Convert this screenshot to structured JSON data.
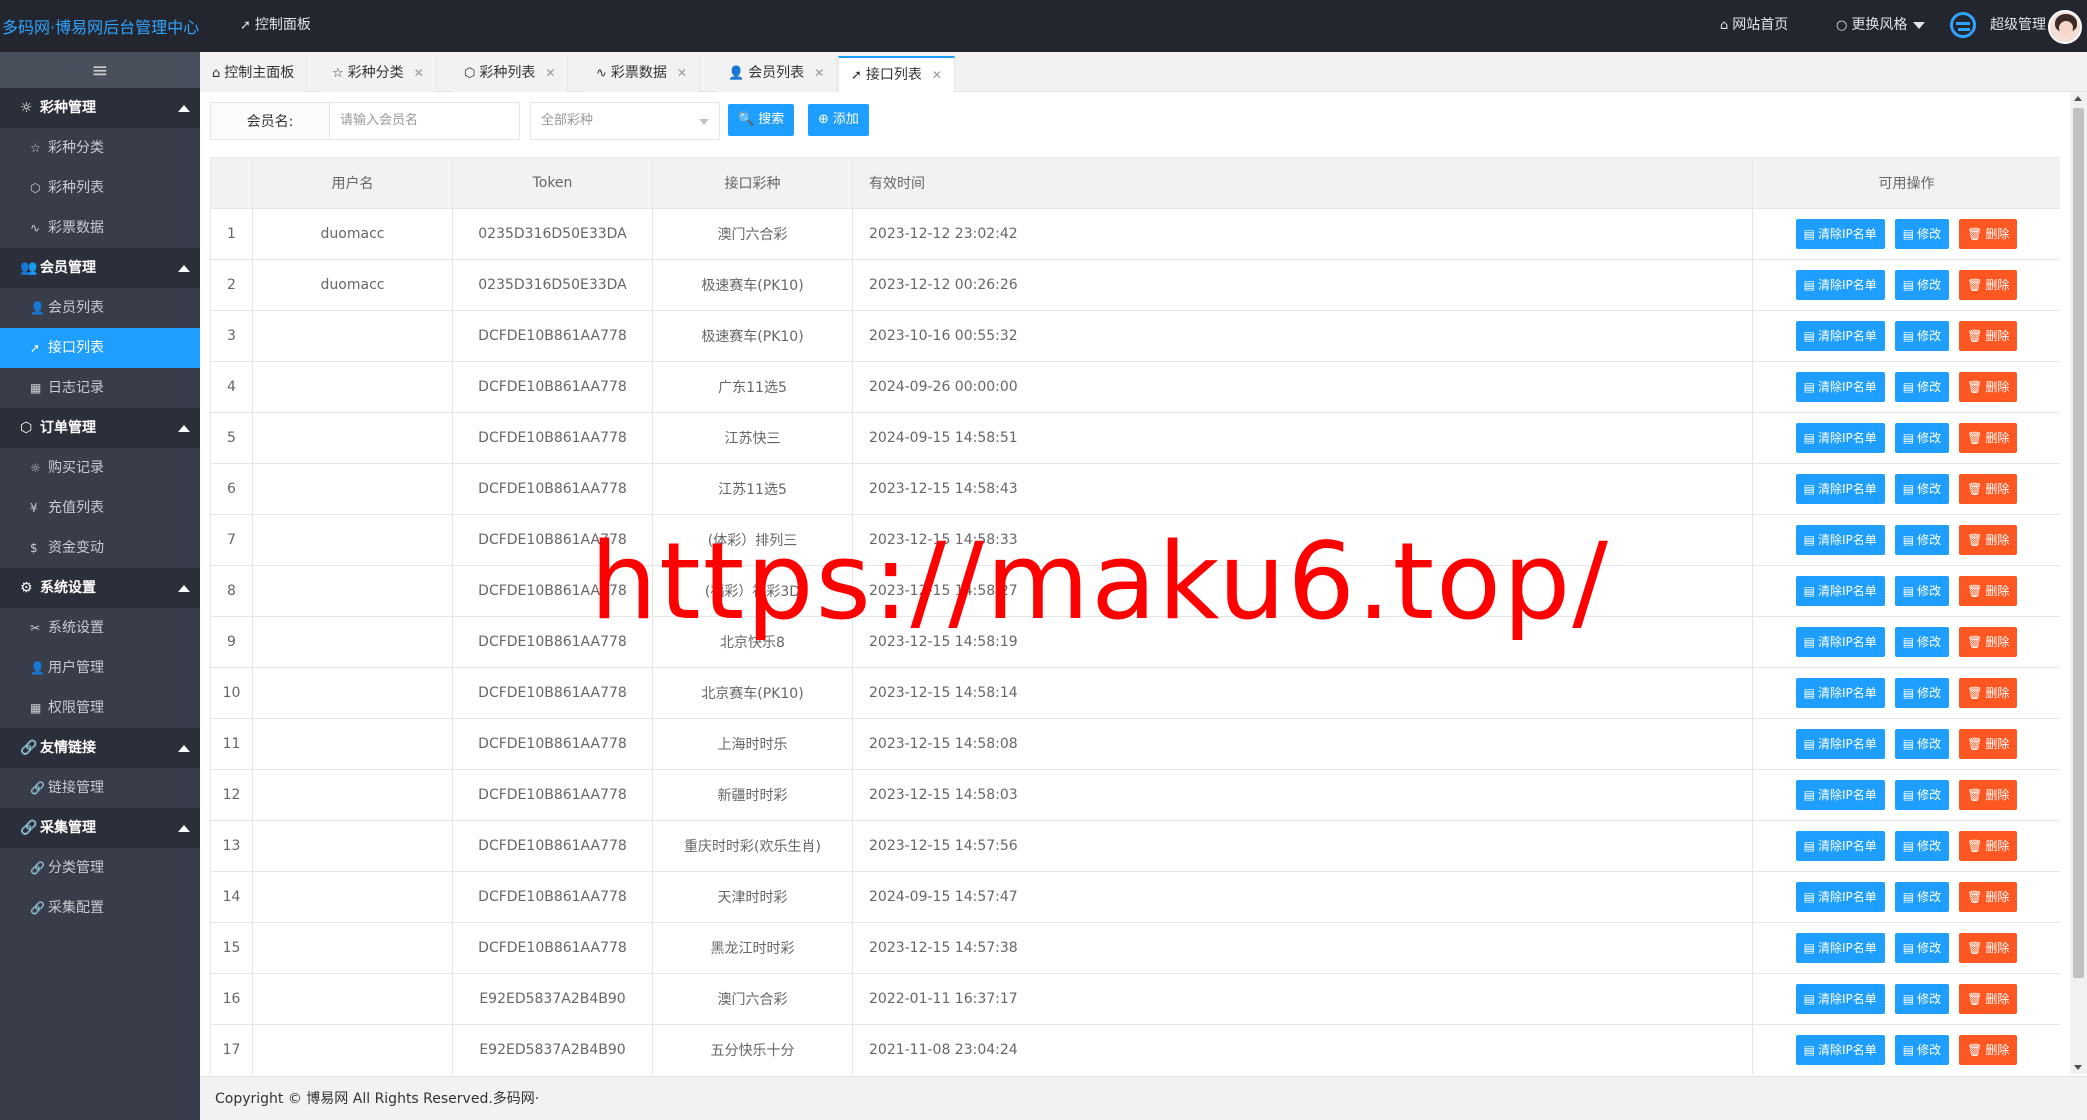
{
  "header": {
    "logo_text": "多码网·博易网后台管理中心",
    "dashboard_label": "控制面板",
    "site_home_label": "网站首页",
    "theme_label": "更换风格",
    "user_label": "超级管理"
  },
  "sidebar": {
    "toggle_icon": "≡",
    "groups": [
      {
        "label": "彩种管理",
        "items": [
          "彩种分类",
          "彩种列表",
          "彩票数据"
        ]
      },
      {
        "label": "会员管理",
        "items": [
          "会员列表",
          "接口列表",
          "日志记录"
        ]
      },
      {
        "label": "订单管理",
        "items": [
          "购买记录",
          "充值列表",
          "资金变动"
        ]
      },
      {
        "label": "系统设置",
        "items": [
          "系统设置",
          "用户管理",
          "权限管理"
        ]
      },
      {
        "label": "友情链接",
        "items": [
          "链接管理"
        ]
      },
      {
        "label": "采集管理",
        "items": [
          "分类管理",
          "采集配置"
        ]
      }
    ],
    "active_item": "接口列表"
  },
  "tabs": [
    "控制主面板",
    "彩种分类",
    "彩种列表",
    "彩票数据",
    "会员列表",
    "接口列表"
  ],
  "active_tab": "接口列表",
  "search": {
    "member_label": "会员名:",
    "member_placeholder": "请输入会员名",
    "lottery_select": "全部彩种",
    "search_button": "搜索",
    "add_button": "添加"
  },
  "table": {
    "headers": [
      "",
      "用户名",
      "Token",
      "接口彩种",
      "有效时间",
      "",
      "可用操作"
    ],
    "actions": {
      "clear_ip": "清除IP名单",
      "edit": "修改",
      "delete": "删除"
    },
    "rows": [
      [
        "1",
        "duomacc",
        "0235D316D50E33DA",
        "澳门六合彩",
        "2023-12-12 23:02:42"
      ],
      [
        "2",
        "duomacc",
        "0235D316D50E33DA",
        "极速赛车(PK10)",
        "2023-12-12 00:26:26"
      ],
      [
        "3",
        "",
        "DCFDE10B861AA778",
        "极速赛车(PK10)",
        "2023-10-16 00:55:32"
      ],
      [
        "4",
        "",
        "DCFDE10B861AA778",
        "广东11选5",
        "2024-09-26 00:00:00"
      ],
      [
        "5",
        "",
        "DCFDE10B861AA778",
        "江苏快三",
        "2024-09-15 14:58:51"
      ],
      [
        "6",
        "",
        "DCFDE10B861AA778",
        "江苏11选5",
        "2023-12-15 14:58:43"
      ],
      [
        "7",
        "",
        "DCFDE10B861AA778",
        "(体彩）排列三",
        "2023-12-15 14:58:33"
      ],
      [
        "8",
        "",
        "DCFDE10B861AA778",
        "(福彩）福彩3D",
        "2023-12-15 14:58:27"
      ],
      [
        "9",
        "",
        "DCFDE10B861AA778",
        "北京快乐8",
        "2023-12-15 14:58:19"
      ],
      [
        "10",
        "",
        "DCFDE10B861AA778",
        "北京赛车(PK10)",
        "2023-12-15 14:58:14"
      ],
      [
        "11",
        "",
        "DCFDE10B861AA778",
        "上海时时乐",
        "2023-12-15 14:58:08"
      ],
      [
        "12",
        "",
        "DCFDE10B861AA778",
        "新疆时时彩",
        "2023-12-15 14:58:03"
      ],
      [
        "13",
        "",
        "DCFDE10B861AA778",
        "重庆时时彩(欢乐生肖)",
        "2023-12-15 14:57:56"
      ],
      [
        "14",
        "",
        "DCFDE10B861AA778",
        "天津时时彩",
        "2024-09-15 14:57:47"
      ],
      [
        "15",
        "",
        "DCFDE10B861AA778",
        "黑龙江时时彩",
        "2023-12-15 14:57:38"
      ],
      [
        "16",
        "",
        "E92ED5837A2B4B90",
        "澳门六合彩",
        "2022-01-11 16:37:17"
      ],
      [
        "17",
        "",
        "E92ED5837A2B4B90",
        "五分快乐十分",
        "2021-11-08 23:04:24"
      ]
    ]
  },
  "footer": {
    "copyright": "Copyright © 博易网 All Rights Reserved.多码网·"
  },
  "watermark": "https://maku6.top/",
  "colors": {
    "accent": "#1e9fff",
    "danger": "#ff5722",
    "sidebar": "#393d49",
    "header": "#23262e"
  }
}
